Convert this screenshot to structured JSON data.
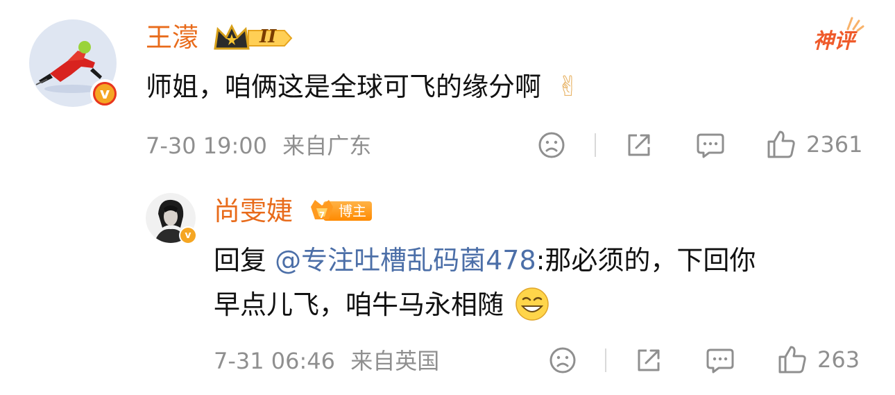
{
  "comments": [
    {
      "username": "王濛",
      "level_badge": "II",
      "tag": "神评",
      "text": "师姐，咱俩这是全球可飞的缘分啊",
      "emoji": "✌",
      "time": "7-30 19:00",
      "location": "来自广东",
      "likes": "2361"
    },
    {
      "username": "尚雯婕",
      "role_badge": "博主",
      "reply_prefix": "回复 ",
      "mention": "@专注吐槽乱码菌478",
      "text_line1": ":那必须的，下回你",
      "text_line2": "早点儿飞，咱牛马永相随",
      "emoji": "😆",
      "time": "7-31 06:46",
      "location": "来自英国",
      "likes": "263"
    }
  ],
  "icons": {
    "verified": "v",
    "dislike": "sad-face-icon",
    "share": "share-icon",
    "comment": "comment-icon",
    "like": "thumbs-up-icon"
  },
  "colors": {
    "username": "#e86b1b",
    "mention": "#4c6fa8",
    "meta": "#8f8f8f",
    "verified": "#f5a623",
    "tag": "#ef5a2a"
  }
}
